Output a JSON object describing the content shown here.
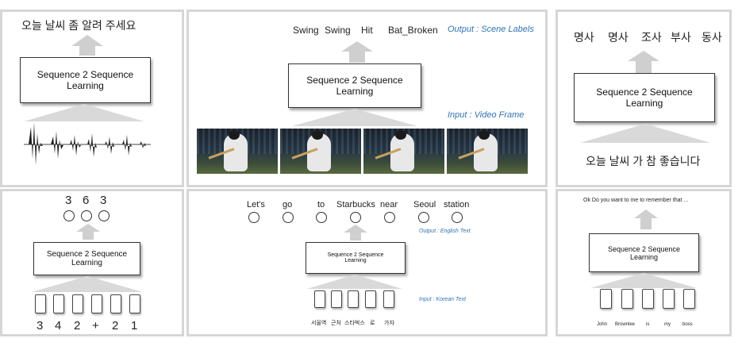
{
  "panel_speech": {
    "output_text": "오늘 날씨  좀  알려  주세요",
    "box_label": "Sequence 2 Sequence Learning"
  },
  "panel_video": {
    "output_labels": [
      "Swing",
      "Swing",
      "Hit",
      "Bat_Broken"
    ],
    "output_caption": "Output : Scene Labels",
    "box_label": "Sequence 2 Sequence Learning",
    "input_caption": "Input : Video Frame"
  },
  "panel_pos": {
    "output_labels": [
      "명사",
      "명사",
      "조사",
      "부사",
      "동사"
    ],
    "box_label": "Sequence 2 Sequence Learning",
    "input_text": "오늘 날씨 가 참 좋습니다"
  },
  "panel_arith": {
    "output_digits": [
      "3",
      "6",
      "3"
    ],
    "box_label": "Sequence 2 Sequence Learning",
    "input_tokens": [
      "3",
      "4",
      "2",
      "+",
      "2",
      "1"
    ]
  },
  "panel_translate": {
    "output_words": [
      "Let's",
      "go",
      "to",
      "Starbucks",
      "near",
      "Seoul",
      "station"
    ],
    "output_caption": "Output : English Text",
    "box_label": "Sequence 2 Sequence Learning",
    "input_caption": "Input : Korean Text",
    "input_words": [
      "서울역",
      "근처",
      "스타벅스",
      "로",
      "가자"
    ]
  },
  "panel_chat": {
    "output_text": "Ok Do you want to me to remember that ...",
    "box_label": "Sequence 2 Sequence Learning",
    "input_words": [
      "John",
      "Brownlee",
      "is",
      "my",
      "boss"
    ]
  }
}
